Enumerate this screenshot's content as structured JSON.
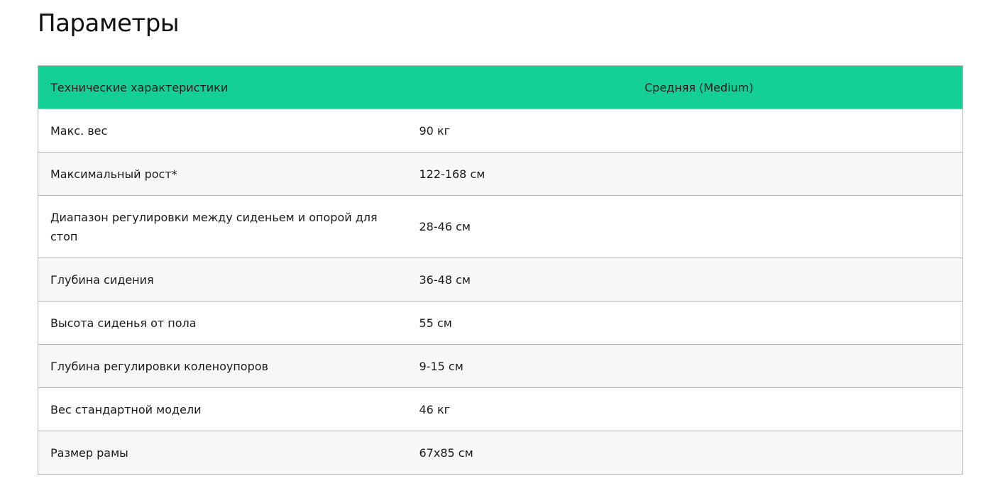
{
  "page": {
    "title": "Параметры"
  },
  "table": {
    "headers": [
      "Технические характеристики",
      "Средняя (Medium)"
    ],
    "rows": [
      {
        "param": "Макс. вес",
        "value": "90 кг"
      },
      {
        "param": "Максимальный рост*",
        "value": "122-168 см"
      },
      {
        "param": "Диапазон регулировки между сиденьем и опорой для стоп",
        "value": "28-46 см"
      },
      {
        "param": "Глубина сидения",
        "value": "36-48 см"
      },
      {
        "param": "Высота сиденья от пола",
        "value": "55 см"
      },
      {
        "param": "Глубина регулировки коленоупоров",
        "value": "9-15 см"
      },
      {
        "param": "Вес стандартной модели",
        "value": "46 кг"
      },
      {
        "param": "Размер рамы",
        "value": "67x85 см"
      }
    ]
  },
  "colors": {
    "header_bg": "#14d097",
    "stripe_bg": "#f6f7f6",
    "border": "#b8b8b8"
  }
}
